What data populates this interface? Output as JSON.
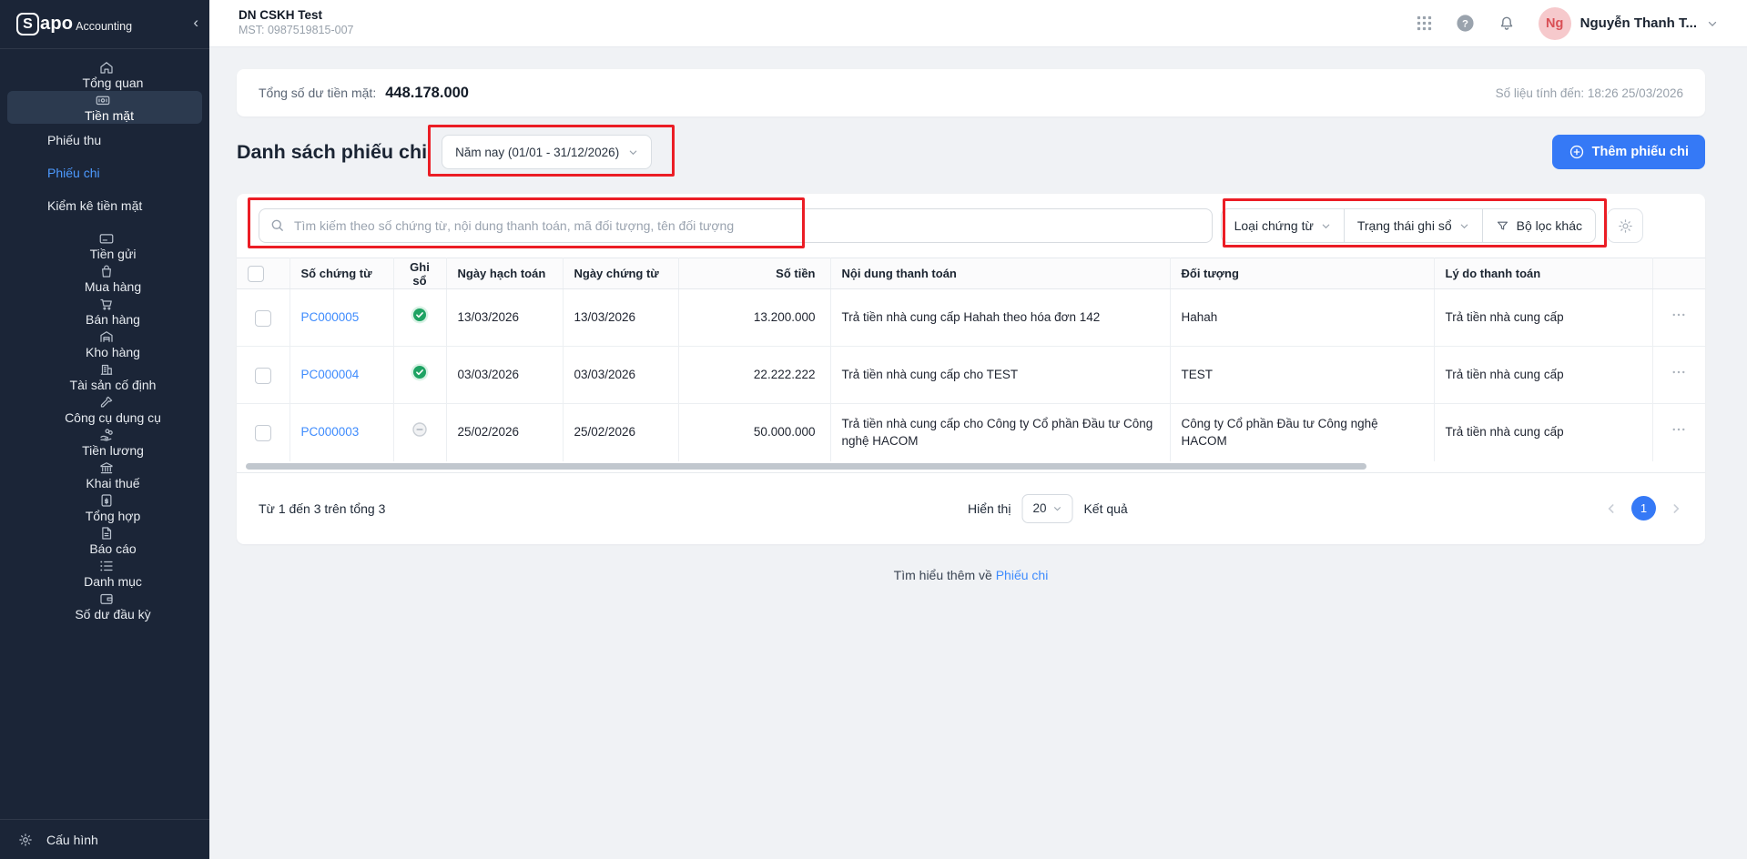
{
  "sidebar": {
    "logo": {
      "brand_initial": "S",
      "brand_rest": "apo",
      "suffix": "Accounting"
    },
    "items": [
      {
        "label": "Tổng quan",
        "icon": "home-icon",
        "type": "main",
        "active": false
      },
      {
        "label": "Tiền mặt",
        "icon": "cash-icon",
        "type": "main",
        "active": true
      },
      {
        "label": "Phiếu thu",
        "type": "sub",
        "active": false
      },
      {
        "label": "Phiếu chi",
        "type": "sub",
        "active": true
      },
      {
        "label": "Kiểm kê tiền mặt",
        "type": "sub",
        "active": false
      },
      {
        "label": "Tiền gửi",
        "icon": "bank-card-icon",
        "type": "main",
        "active": false,
        "gap": true
      },
      {
        "label": "Mua hàng",
        "icon": "shopping-bag-icon",
        "type": "main",
        "active": false
      },
      {
        "label": "Bán hàng",
        "icon": "cart-icon",
        "type": "main",
        "active": false
      },
      {
        "label": "Kho hàng",
        "icon": "warehouse-icon",
        "type": "main",
        "active": false
      },
      {
        "label": "Tài sản cố định",
        "icon": "building-icon",
        "type": "main",
        "active": false
      },
      {
        "label": "Công cụ dụng cụ",
        "icon": "tool-icon",
        "type": "main",
        "active": false
      },
      {
        "label": "Tiền lương",
        "icon": "salary-icon",
        "type": "main",
        "active": false
      },
      {
        "label": "Khai thuế",
        "icon": "tax-icon",
        "type": "main",
        "active": false
      },
      {
        "label": "Tổng hợp",
        "icon": "summary-doc-icon",
        "type": "main",
        "active": false
      },
      {
        "label": "Báo cáo",
        "icon": "report-icon",
        "type": "main",
        "active": false
      },
      {
        "label": "Danh mục",
        "icon": "list-icon",
        "type": "main",
        "active": false
      },
      {
        "label": "Số dư đầu kỳ",
        "icon": "wallet-icon",
        "type": "main",
        "active": false
      }
    ],
    "footer_item": {
      "label": "Cấu hình",
      "icon": "gear-icon"
    }
  },
  "topbar": {
    "company_name": "DN CSKH Test",
    "tax_code": "MST: 0987519815-007",
    "user": {
      "avatar_initials": "Ng",
      "name": "Nguyễn Thanh T..."
    }
  },
  "summary": {
    "label": "Tổng số dư tiền mặt:",
    "value": "448.178.000",
    "updated": "Số liệu tính đến: 18:26 25/03/2026"
  },
  "page": {
    "title": "Danh sách phiếu chi",
    "period_filter": "Năm nay (01/01 - 31/12/2026)",
    "add_button": "Thêm phiếu chi"
  },
  "toolbar": {
    "search_placeholder": "Tìm kiếm theo số chứng từ, nội dung thanh toán, mã đối tượng, tên đối tượng",
    "filters": [
      {
        "label": "Loại chứng từ",
        "has_caret": true,
        "has_funnel": false
      },
      {
        "label": "Trạng thái ghi sổ",
        "has_caret": true,
        "has_funnel": false
      },
      {
        "label": "Bộ lọc khác",
        "has_caret": false,
        "has_funnel": true
      }
    ]
  },
  "table": {
    "columns": [
      "",
      "Số chứng từ",
      "Ghi sổ",
      "Ngày hạch toán",
      "Ngày chứng từ",
      "Số tiền",
      "Nội dung thanh toán",
      "Đối tượng",
      "Lý do thanh toán",
      ""
    ],
    "rows": [
      {
        "code": "PC000005",
        "posted": true,
        "posting_date": "13/03/2026",
        "doc_date": "13/03/2026",
        "amount": "13.200.000",
        "description": "Trả tiền nhà cung cấp Hahah theo hóa đơn 142",
        "partner": "Hahah",
        "reason": "Trả tiền nhà cung cấp"
      },
      {
        "code": "PC000004",
        "posted": true,
        "posting_date": "03/03/2026",
        "doc_date": "03/03/2026",
        "amount": "22.222.222",
        "description": "Trả tiền nhà cung cấp cho TEST",
        "partner": "TEST",
        "reason": "Trả tiền nhà cung cấp"
      },
      {
        "code": "PC000003",
        "posted": false,
        "posting_date": "25/02/2026",
        "doc_date": "25/02/2026",
        "amount": "50.000.000",
        "description": "Trả tiền nhà cung cấp cho Công ty Cổ phần Đầu tư Công nghệ HACOM",
        "partner": "Công ty Cổ phần Đầu tư Công nghệ HACOM",
        "reason": "Trả tiền nhà cung cấp"
      }
    ]
  },
  "pagination": {
    "range_text": "Từ 1 đến 3 trên tổng 3",
    "per_page_label": "Hiển thị",
    "per_page_value": "20",
    "results_label": "Kết quả",
    "current_page": "1"
  },
  "footer_note": {
    "text": "Tìm hiểu thêm về",
    "link": "Phiếu chi"
  },
  "colors": {
    "accent_blue": "#3579F6",
    "link_blue": "#3E8BFD",
    "posted_green": "#1EA363",
    "annotation_red": "#EB1D25",
    "sidebar_bg": "#1B2537"
  }
}
